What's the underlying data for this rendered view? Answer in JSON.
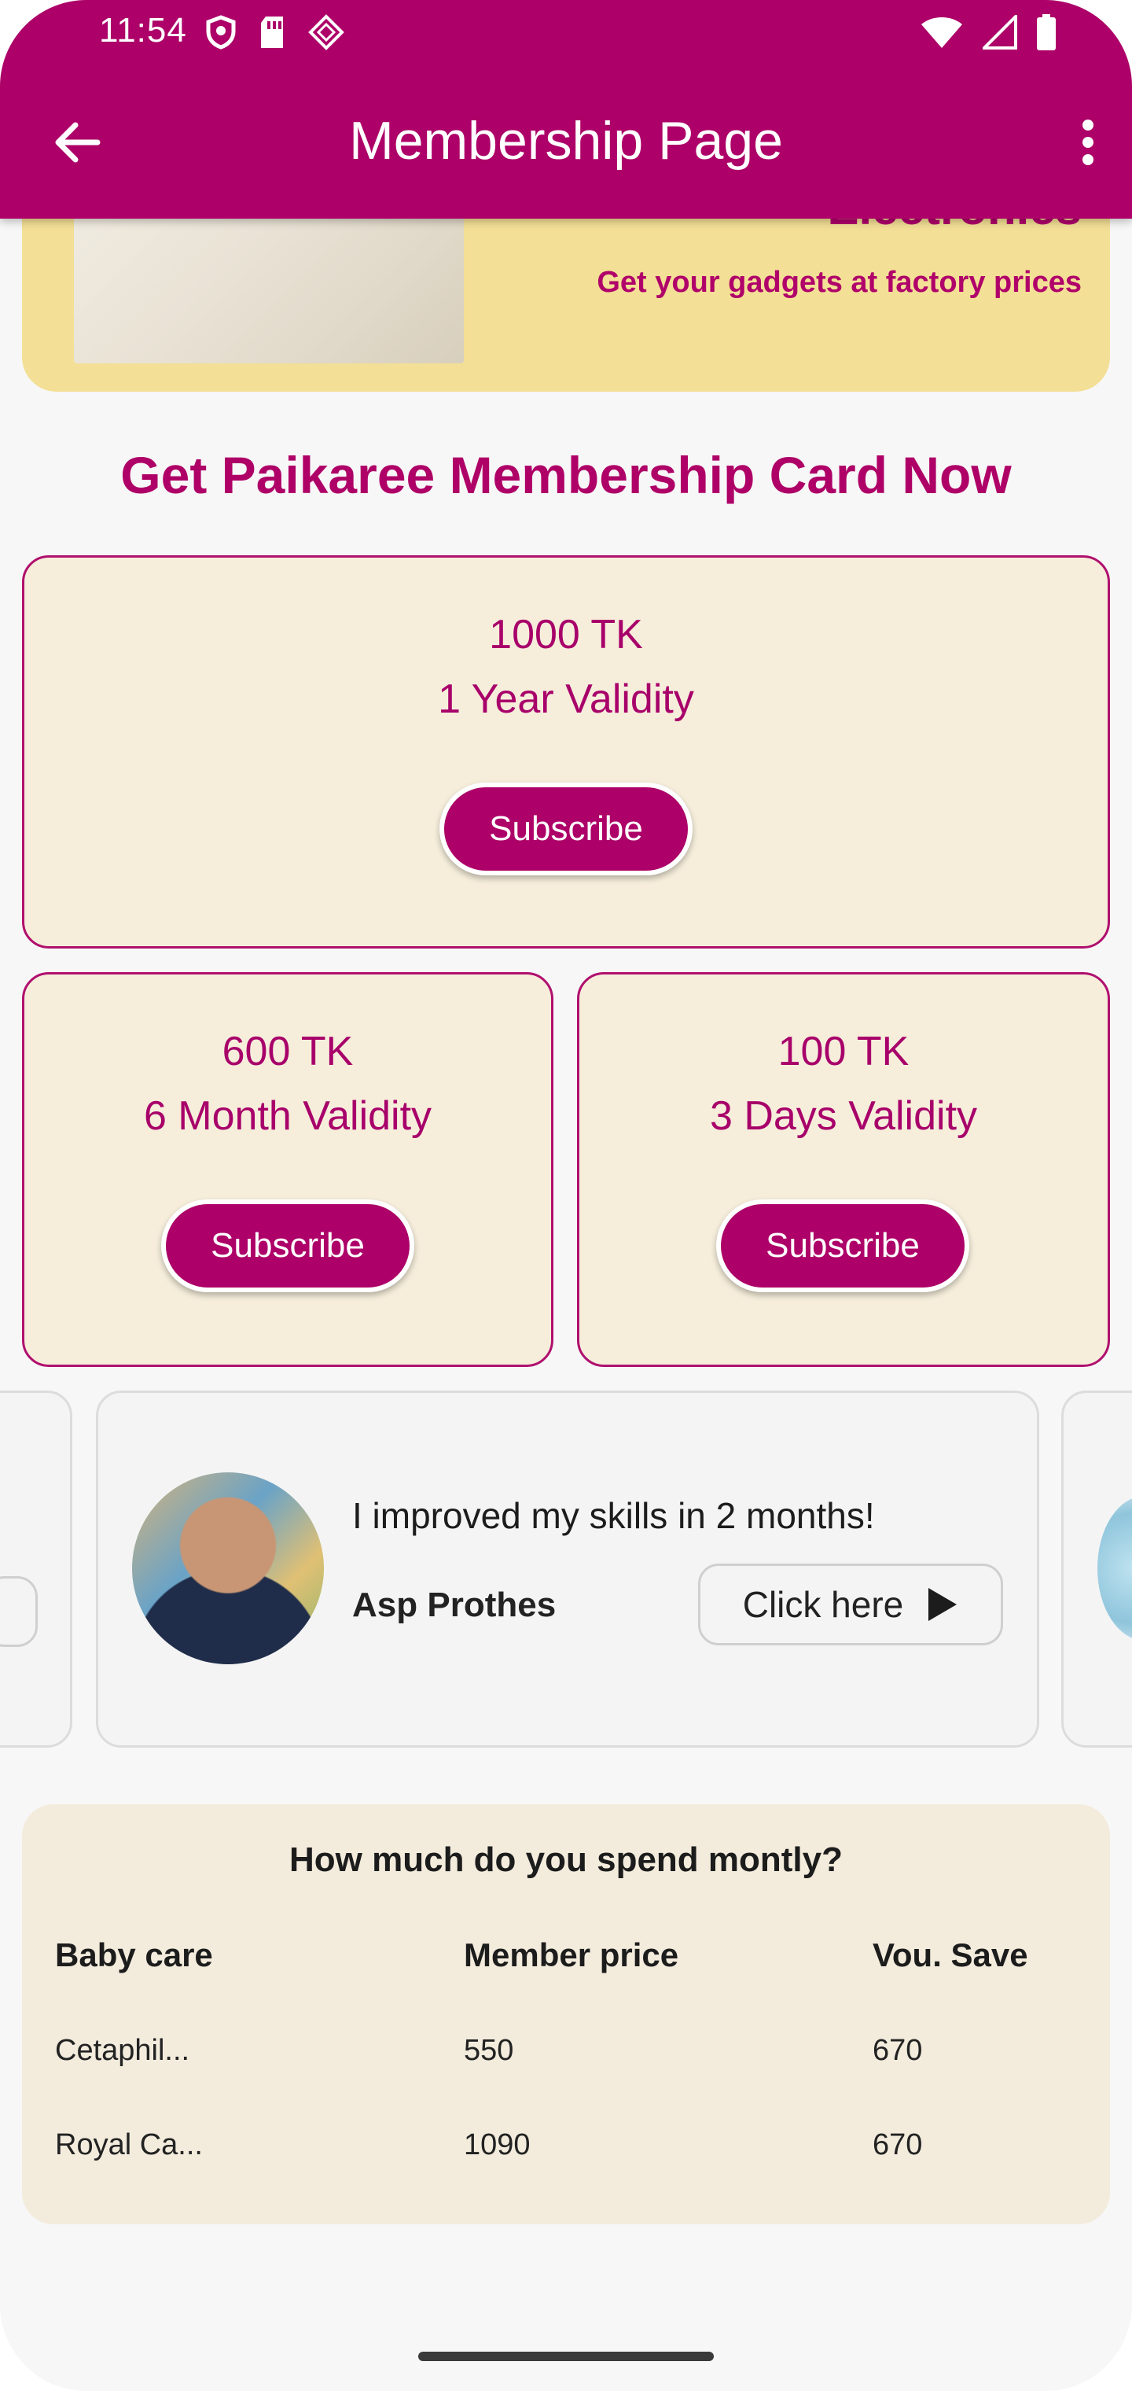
{
  "status_bar": {
    "time": "11:54"
  },
  "app_bar": {
    "title": "Membership Page"
  },
  "banner": {
    "heading": "Electronics",
    "subtitle": "Get your gadgets at factory prices"
  },
  "section_title": "Get Paikaree Membership Card Now",
  "plans": [
    {
      "price": "1000 TK",
      "validity": "1 Year Validity",
      "button": "Subscribe"
    },
    {
      "price": "600 TK",
      "validity": "6 Month Validity",
      "button": "Subscribe"
    },
    {
      "price": "100 TK",
      "validity": "3 Days Validity",
      "button": "Subscribe"
    }
  ],
  "testimonial": {
    "quote": "I improved my skills in 2 months!",
    "name": "Asp Prothes",
    "button": "Click here"
  },
  "spend": {
    "title": "How much do you spend montly?",
    "headers": [
      "Baby care",
      "Member price",
      "Vou. Save"
    ],
    "rows": [
      [
        "Cetaphil...",
        "550",
        "670"
      ],
      [
        "Royal Ca...",
        "1090",
        "670"
      ]
    ]
  },
  "colors": {
    "primary": "#ad0068",
    "banner_bg": "#f3df95",
    "card_bg": "#f6eedb",
    "table_bg": "#f3ecdd"
  }
}
